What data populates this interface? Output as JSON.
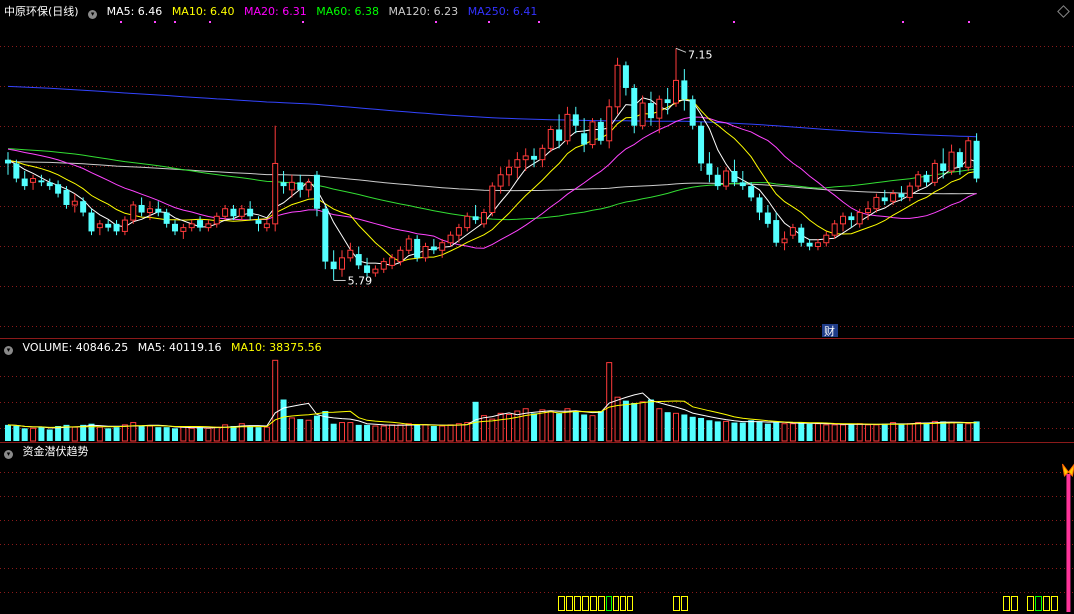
{
  "main_panel": {
    "stock_title": "中原环保(日线)",
    "ma_legend": [
      {
        "label": "MA5: 6.46",
        "color": "#ffffff"
      },
      {
        "label": "MA10: 6.40",
        "color": "#ffff00"
      },
      {
        "label": "MA20: 6.31",
        "color": "#ff00ff"
      },
      {
        "label": "MA60: 6.38",
        "color": "#00ff00"
      },
      {
        "label": "MA120: 6.23",
        "color": "#cccccc"
      },
      {
        "label": "MA250: 6.41",
        "color": "#3333ff"
      }
    ],
    "high_label": "7.15",
    "low_label": "5.79",
    "finance_badge": "财"
  },
  "volume_panel": {
    "label": "VOLUME: 40846.25",
    "ma5": "MA5: 40119.16",
    "ma10": "MA10: 38375.56"
  },
  "indicator_panel": {
    "label": "资金潜伏趋势"
  },
  "colors": {
    "up": "#ff3b3b",
    "down": "#54ffff",
    "ma5": "#ffffff",
    "ma10": "#ffff00",
    "ma20": "#ff44ff",
    "ma60": "#33dd33",
    "ma120": "#cccccc",
    "ma250": "#3344ff",
    "grid": "#8b1a1a",
    "signal": "#ff3399"
  },
  "chart_data": {
    "type": "candlestick",
    "price_ylim": [
      5.7,
      7.3
    ],
    "candles": [
      [
        6.56,
        6.6,
        6.48,
        6.54
      ],
      [
        6.54,
        6.56,
        6.44,
        6.46
      ],
      [
        6.46,
        6.5,
        6.4,
        6.42
      ],
      [
        6.44,
        6.48,
        6.4,
        6.46
      ],
      [
        6.45,
        6.48,
        6.42,
        6.44
      ],
      [
        6.44,
        6.46,
        6.4,
        6.42
      ],
      [
        6.43,
        6.45,
        6.36,
        6.38
      ],
      [
        6.4,
        6.42,
        6.3,
        6.32
      ],
      [
        6.32,
        6.38,
        6.28,
        6.34
      ],
      [
        6.34,
        6.36,
        6.26,
        6.28
      ],
      [
        6.28,
        6.3,
        6.16,
        6.18
      ],
      [
        6.2,
        6.24,
        6.16,
        6.22
      ],
      [
        6.22,
        6.24,
        6.18,
        6.2
      ],
      [
        6.22,
        6.24,
        6.16,
        6.18
      ],
      [
        6.18,
        6.26,
        6.16,
        6.24
      ],
      [
        6.24,
        6.34,
        6.22,
        6.32
      ],
      [
        6.32,
        6.36,
        6.26,
        6.28
      ],
      [
        6.28,
        6.34,
        6.24,
        6.3
      ],
      [
        6.3,
        6.34,
        6.26,
        6.28
      ],
      [
        6.28,
        6.3,
        6.2,
        6.22
      ],
      [
        6.22,
        6.24,
        6.16,
        6.18
      ],
      [
        6.18,
        6.22,
        6.14,
        6.2
      ],
      [
        6.2,
        6.24,
        6.18,
        6.22
      ],
      [
        6.24,
        6.26,
        6.18,
        6.2
      ],
      [
        6.2,
        6.24,
        6.18,
        6.22
      ],
      [
        6.22,
        6.28,
        6.2,
        6.26
      ],
      [
        6.26,
        6.32,
        6.24,
        6.3
      ],
      [
        6.3,
        6.32,
        6.24,
        6.26
      ],
      [
        6.26,
        6.32,
        6.24,
        6.3
      ],
      [
        6.3,
        6.34,
        6.24,
        6.26
      ],
      [
        6.24,
        6.26,
        6.18,
        6.22
      ],
      [
        6.2,
        6.24,
        6.18,
        6.22
      ],
      [
        6.22,
        6.74,
        6.18,
        6.54
      ],
      [
        6.44,
        6.5,
        6.38,
        6.42
      ],
      [
        6.4,
        6.48,
        6.36,
        6.44
      ],
      [
        6.44,
        6.48,
        6.36,
        6.4
      ],
      [
        6.4,
        6.46,
        6.36,
        6.44
      ],
      [
        6.48,
        6.5,
        6.26,
        6.3
      ],
      [
        6.3,
        6.32,
        5.98,
        6.02
      ],
      [
        6.02,
        6.08,
        5.92,
        5.98
      ],
      [
        5.98,
        6.08,
        5.94,
        6.04
      ],
      [
        6.04,
        6.12,
        6.02,
        6.08
      ],
      [
        6.06,
        6.1,
        5.98,
        6.0
      ],
      [
        6.0,
        6.04,
        5.94,
        5.96
      ],
      [
        5.96,
        6.0,
        5.94,
        5.98
      ],
      [
        5.98,
        6.04,
        5.96,
        6.02
      ],
      [
        6.0,
        6.06,
        5.98,
        6.04
      ],
      [
        6.02,
        6.1,
        6.0,
        6.08
      ],
      [
        6.08,
        6.16,
        6.06,
        6.14
      ],
      [
        6.14,
        6.16,
        6.02,
        6.04
      ],
      [
        6.04,
        6.12,
        6.02,
        6.1
      ],
      [
        6.1,
        6.14,
        6.06,
        6.08
      ],
      [
        6.08,
        6.14,
        6.04,
        6.12
      ],
      [
        6.12,
        6.18,
        6.1,
        6.16
      ],
      [
        6.16,
        6.22,
        6.12,
        6.2
      ],
      [
        6.2,
        6.28,
        6.18,
        6.26
      ],
      [
        6.26,
        6.32,
        6.22,
        6.24
      ],
      [
        6.22,
        6.3,
        6.2,
        6.28
      ],
      [
        6.28,
        6.44,
        6.26,
        6.42
      ],
      [
        6.42,
        6.52,
        6.38,
        6.48
      ],
      [
        6.48,
        6.56,
        6.42,
        6.52
      ],
      [
        6.52,
        6.6,
        6.46,
        6.56
      ],
      [
        6.56,
        6.62,
        6.5,
        6.58
      ],
      [
        6.58,
        6.62,
        6.52,
        6.56
      ],
      [
        6.56,
        6.64,
        6.52,
        6.62
      ],
      [
        6.62,
        6.74,
        6.6,
        6.72
      ],
      [
        6.72,
        6.8,
        6.62,
        6.66
      ],
      [
        6.66,
        6.84,
        6.64,
        6.8
      ],
      [
        6.8,
        6.84,
        6.7,
        6.74
      ],
      [
        6.7,
        6.78,
        6.6,
        6.64
      ],
      [
        6.64,
        6.78,
        6.62,
        6.76
      ],
      [
        6.76,
        6.78,
        6.64,
        6.66
      ],
      [
        6.66,
        6.88,
        6.62,
        6.84
      ],
      [
        6.84,
        7.1,
        6.8,
        7.06
      ],
      [
        7.06,
        7.08,
        6.9,
        6.94
      ],
      [
        6.94,
        6.96,
        6.7,
        6.74
      ],
      [
        6.74,
        6.9,
        6.72,
        6.86
      ],
      [
        6.86,
        6.92,
        6.74,
        6.78
      ],
      [
        6.78,
        6.9,
        6.7,
        6.88
      ],
      [
        6.88,
        6.94,
        6.8,
        6.86
      ],
      [
        6.86,
        7.15,
        6.84,
        6.98
      ],
      [
        6.98,
        7.04,
        6.82,
        6.88
      ],
      [
        6.88,
        6.9,
        6.72,
        6.74
      ],
      [
        6.74,
        6.76,
        6.5,
        6.54
      ],
      [
        6.54,
        6.6,
        6.44,
        6.48
      ],
      [
        6.48,
        6.52,
        6.4,
        6.42
      ],
      [
        6.42,
        6.52,
        6.4,
        6.5
      ],
      [
        6.5,
        6.56,
        6.42,
        6.44
      ],
      [
        6.44,
        6.5,
        6.4,
        6.42
      ],
      [
        6.42,
        6.44,
        6.34,
        6.36
      ],
      [
        6.36,
        6.38,
        6.24,
        6.28
      ],
      [
        6.28,
        6.32,
        6.2,
        6.22
      ],
      [
        6.24,
        6.28,
        6.1,
        6.12
      ],
      [
        6.12,
        6.18,
        6.08,
        6.14
      ],
      [
        6.16,
        6.22,
        6.14,
        6.2
      ],
      [
        6.2,
        6.22,
        6.1,
        6.12
      ],
      [
        6.12,
        6.14,
        6.08,
        6.1
      ],
      [
        6.1,
        6.14,
        6.08,
        6.12
      ],
      [
        6.12,
        6.18,
        6.1,
        6.16
      ],
      [
        6.16,
        6.24,
        6.14,
        6.22
      ],
      [
        6.22,
        6.28,
        6.18,
        6.26
      ],
      [
        6.26,
        6.28,
        6.2,
        6.24
      ],
      [
        6.22,
        6.3,
        6.2,
        6.28
      ],
      [
        6.28,
        6.34,
        6.24,
        6.3
      ],
      [
        6.3,
        6.38,
        6.28,
        6.36
      ],
      [
        6.36,
        6.4,
        6.32,
        6.34
      ],
      [
        6.34,
        6.4,
        6.32,
        6.38
      ],
      [
        6.38,
        6.42,
        6.34,
        6.36
      ],
      [
        6.36,
        6.44,
        6.34,
        6.42
      ],
      [
        6.42,
        6.5,
        6.4,
        6.48
      ],
      [
        6.48,
        6.5,
        6.42,
        6.44
      ],
      [
        6.44,
        6.56,
        6.42,
        6.54
      ],
      [
        6.54,
        6.62,
        6.46,
        6.5
      ],
      [
        6.5,
        6.64,
        6.48,
        6.6
      ],
      [
        6.6,
        6.62,
        6.48,
        6.52
      ],
      [
        6.52,
        6.68,
        6.5,
        6.66
      ],
      [
        6.66,
        6.7,
        6.44,
        6.46
      ]
    ],
    "volumes": [
      14,
      13,
      11,
      11,
      12,
      10,
      13,
      14,
      12,
      14,
      15,
      12,
      11,
      12,
      14,
      16,
      13,
      13,
      12,
      12,
      11,
      12,
      11,
      12,
      11,
      12,
      14,
      13,
      15,
      13,
      12,
      12,
      70,
      36,
      20,
      19,
      18,
      22,
      26,
      15,
      16,
      16,
      14,
      14,
      13,
      13,
      14,
      14,
      15,
      14,
      14,
      13,
      13,
      14,
      15,
      16,
      34,
      22,
      19,
      24,
      23,
      26,
      28,
      24,
      27,
      26,
      24,
      28,
      26,
      23,
      22,
      26,
      68,
      38,
      35,
      33,
      34,
      36,
      28,
      25,
      24,
      23,
      21,
      20,
      18,
      17,
      17,
      16,
      16,
      18,
      17,
      15,
      16,
      15,
      15,
      16,
      15,
      15,
      14,
      14,
      14,
      15,
      15,
      14,
      14,
      15,
      16,
      15,
      15,
      16,
      16,
      17,
      17,
      16,
      15,
      15,
      17
    ],
    "signal_index": 127,
    "bottom_marker_bars": [
      [
        558,
        565,
        "#ffff00"
      ],
      [
        566,
        573,
        "#ffff00"
      ],
      [
        574,
        581,
        "#ffff00"
      ],
      [
        582,
        589,
        "#ffff00"
      ],
      [
        590,
        597,
        "#ffff00"
      ],
      [
        598,
        605,
        "#ffff00"
      ],
      [
        606,
        612,
        "#00ff00"
      ],
      [
        613,
        619,
        "#ffff00"
      ],
      [
        620,
        626,
        "#ffff00"
      ],
      [
        627,
        633,
        "#ffff00"
      ],
      [
        673,
        680,
        "#ffff00"
      ],
      [
        681,
        688,
        "#ffff00"
      ],
      [
        1003,
        1010,
        "#ffff00"
      ],
      [
        1011,
        1018,
        "#ffff00"
      ],
      [
        1027,
        1034,
        "#ffff00"
      ],
      [
        1035,
        1042,
        "#00ff00"
      ],
      [
        1043,
        1050,
        "#ffff00"
      ],
      [
        1051,
        1058,
        "#ffff00"
      ]
    ]
  }
}
